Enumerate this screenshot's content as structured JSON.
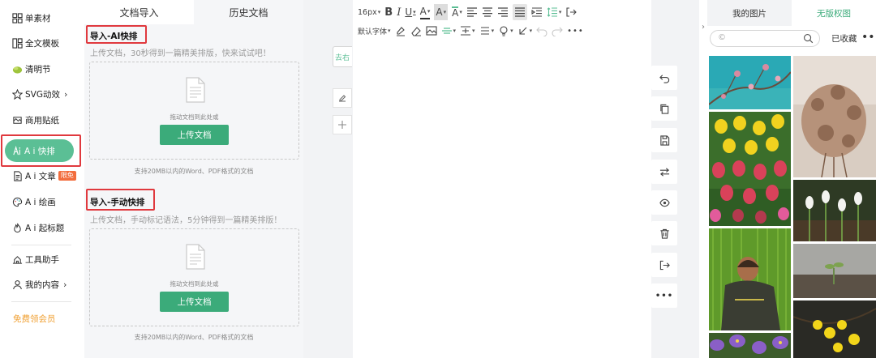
{
  "nav": {
    "items": [
      {
        "label": "单素材",
        "icon": "grid-icon"
      },
      {
        "label": "全文模板",
        "icon": "template-icon"
      },
      {
        "label": "清明节",
        "icon": "qingming-icon"
      },
      {
        "label": "SVG动效",
        "icon": "star-icon",
        "chevron": "›"
      },
      {
        "label": "商用贴纸",
        "icon": "sticker-icon"
      },
      {
        "label": "A i 快排",
        "icon": "ai-layout-icon",
        "active": true
      },
      {
        "label": "A i 文章",
        "icon": "ai-article-icon",
        "badge": "限免"
      },
      {
        "label": "A i 绘画",
        "icon": "palette-icon"
      },
      {
        "label": "A i 起标题",
        "icon": "ai-title-icon"
      },
      {
        "label": "工具助手",
        "icon": "tools-icon"
      },
      {
        "label": "我的内容",
        "icon": "user-icon",
        "chevron": "›"
      }
    ],
    "vip": "免费领会员"
  },
  "panel": {
    "tabs": [
      "文档导入",
      "历史文档"
    ],
    "ai_section": {
      "title": "导入-AI快排",
      "desc": "上传文档，30秒得到一篇精美排版，快来试试吧！",
      "hint": "拖动文档到此处或",
      "button": "上传文档",
      "note": "支持20MB以内的Word、PDF格式的文档"
    },
    "manual_section": {
      "title": "导入-手动快排",
      "desc": "上传文档，手动标记语法，5分钟得到一篇精美排版！",
      "hint": "拖动文档到此处或",
      "button": "上传文档",
      "note": "支持20MB以内的Word、PDF格式的文档"
    }
  },
  "gutter": {
    "tag": "去右"
  },
  "editor": {
    "font_size": "16px",
    "font_family": "默认字体"
  },
  "images": {
    "tabs": [
      "我的图片",
      "无版权图"
    ],
    "search_placeholder": "©",
    "favorites": "已收藏",
    "more": "•••"
  },
  "colors": {
    "accent": "#3bab7a",
    "active_nav": "#5bbf95",
    "highlight": "#e0393e",
    "vip": "#f0a033"
  }
}
